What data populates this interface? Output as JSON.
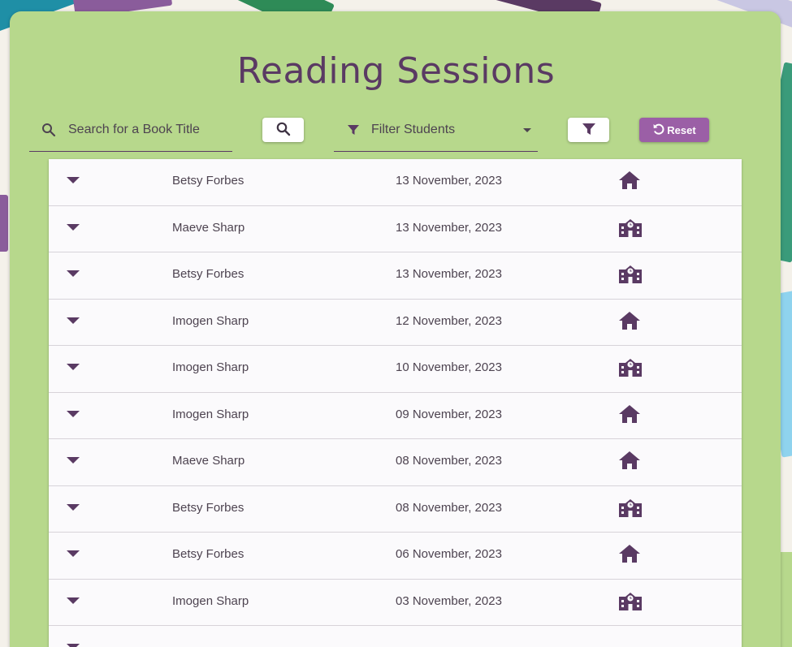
{
  "page": {
    "title": "Reading Sessions"
  },
  "toolbar": {
    "search_placeholder": "Search for a Book Title",
    "filter_label": "Filter Students",
    "reset_label": "Reset"
  },
  "colors": {
    "panel": "#b7d88c",
    "accent": "#5a3a63",
    "reset_button": "#9b5fa6"
  },
  "sessions": [
    {
      "student": "Betsy Forbes",
      "date": "13 November, 2023",
      "location": "home-icon"
    },
    {
      "student": "Maeve Sharp",
      "date": "13 November, 2023",
      "location": "school-icon"
    },
    {
      "student": "Betsy Forbes",
      "date": "13 November, 2023",
      "location": "school-icon"
    },
    {
      "student": "Imogen Sharp",
      "date": "12 November, 2023",
      "location": "home-icon"
    },
    {
      "student": "Imogen Sharp",
      "date": "10 November, 2023",
      "location": "school-icon"
    },
    {
      "student": "Imogen Sharp",
      "date": "09 November, 2023",
      "location": "home-icon"
    },
    {
      "student": "Maeve Sharp",
      "date": "08 November, 2023",
      "location": "home-icon"
    },
    {
      "student": "Betsy Forbes",
      "date": "08 November, 2023",
      "location": "school-icon"
    },
    {
      "student": "Betsy Forbes",
      "date": "06 November, 2023",
      "location": "home-icon"
    },
    {
      "student": "Imogen Sharp",
      "date": "03 November, 2023",
      "location": "school-icon"
    }
  ]
}
